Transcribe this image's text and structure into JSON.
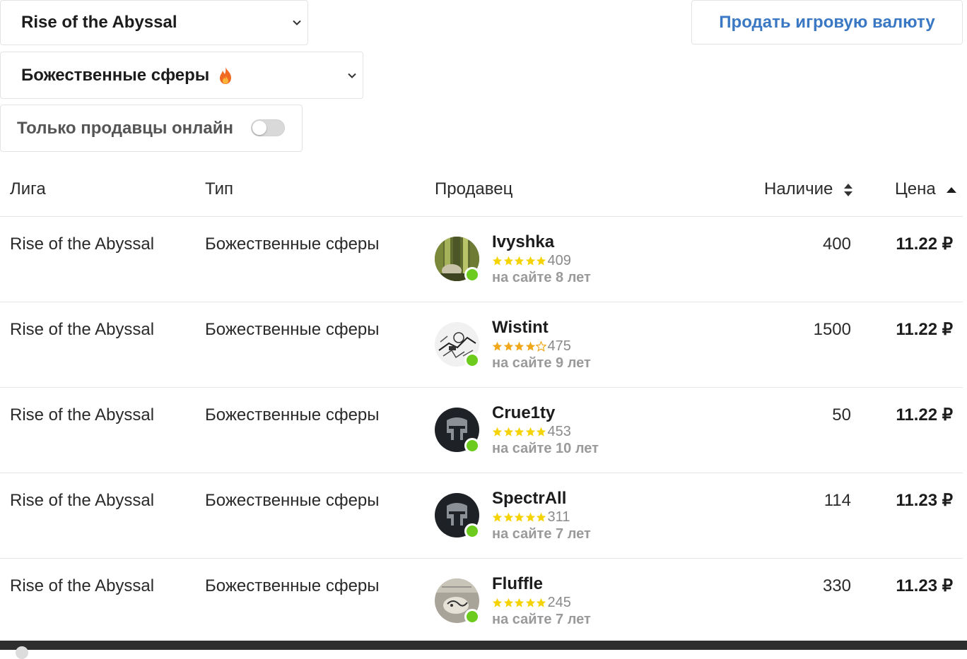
{
  "filters": {
    "league_value": "Rise of the Abyssal",
    "type_value": "Божественные сферы",
    "online_only_label": "Только продавцы онлайн",
    "online_only_enabled": false
  },
  "actions": {
    "sell_currency_label": "Продать игровую валюту"
  },
  "table": {
    "columns": {
      "league": "Лига",
      "type": "Тип",
      "seller": "Продавец",
      "stock": "Наличие",
      "price": "Цена"
    },
    "rows": [
      {
        "league": "Rise of the Abyssal",
        "type": "Божественные сферы",
        "seller": "Ivyshka",
        "stars": 5,
        "reviews": "409",
        "tenure": "на сайте 8 лет",
        "online": true,
        "stock": "400",
        "price": "11.22 ₽"
      },
      {
        "league": "Rise of the Abyssal",
        "type": "Божественные сферы",
        "seller": "Wistint",
        "stars": 4,
        "reviews": "475",
        "tenure": "на сайте 9 лет",
        "online": true,
        "stock": "1500",
        "price": "11.22 ₽"
      },
      {
        "league": "Rise of the Abyssal",
        "type": "Божественные сферы",
        "seller": "Crue1ty",
        "stars": 5,
        "reviews": "453",
        "tenure": "на сайте 10 лет",
        "online": true,
        "stock": "50",
        "price": "11.22 ₽"
      },
      {
        "league": "Rise of the Abyssal",
        "type": "Божественные сферы",
        "seller": "SpectrAll",
        "stars": 5,
        "reviews": "311",
        "tenure": "на сайте 7 лет",
        "online": true,
        "stock": "114",
        "price": "11.23 ₽"
      },
      {
        "league": "Rise of the Abyssal",
        "type": "Божественные сферы",
        "seller": "Fluffle",
        "stars": 5,
        "reviews": "245",
        "tenure": "на сайте 7 лет",
        "online": true,
        "stock": "330",
        "price": "11.23 ₽"
      }
    ]
  },
  "colors": {
    "accent_link": "#3a78c4",
    "online_dot": "#6ccb1d",
    "star_full_5": "#f5d300",
    "star_full_4": "#f0a81a"
  },
  "icons": {
    "select_chevron": "chevron-down-icon",
    "hot_badge": "fire-icon",
    "stock_sort": "sort-both-icon",
    "price_sort": "sort-asc-icon",
    "rating": "star-icon"
  }
}
